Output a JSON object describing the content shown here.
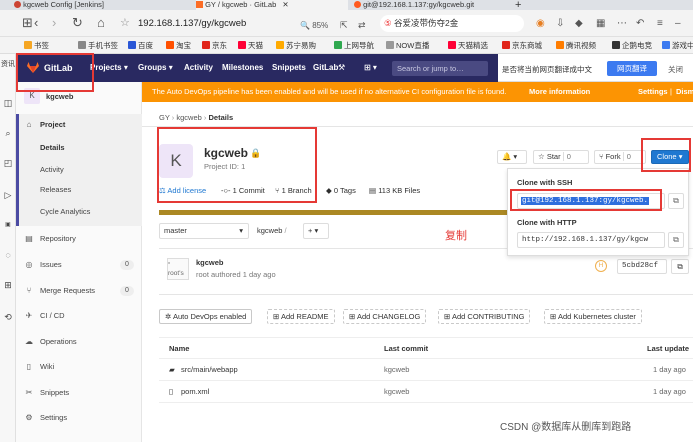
{
  "browser": {
    "tabs": [
      {
        "title": "kgcweb Config [Jenkins]",
        "active": false
      },
      {
        "title": "GY / kgcweb · GitLab",
        "active": true
      },
      {
        "title": "git@192.168.1.137:gy/kgcweb.git",
        "active": false
      }
    ],
    "new_tab": "+",
    "url": "192.168.1.137/gy/kgcweb",
    "zoom": "85%",
    "search_text": "谷爱凌带伤夺2金",
    "bookmarks": [
      "书签",
      "手机书签",
      "百度",
      "淘宝",
      "京东",
      "天猫",
      "苏宁易购",
      "上网导航",
      "NOW直播",
      "天猫精选",
      "京东商城",
      "腾讯视频",
      "企鹅电竞",
      "游戏中"
    ],
    "side_label": "资讯"
  },
  "gitlab": {
    "logo_text": "GitLab",
    "nav": [
      "Projects",
      "Groups",
      "Activity",
      "Milestones",
      "Snippets",
      "GitLab"
    ],
    "search_placeholder": "Search or jump to…"
  },
  "translate_bar": {
    "prompt": "是否将当前网页翻译成中文",
    "button": "网页翻译",
    "close": "关闭"
  },
  "banner": {
    "text": "The Auto DevOps pipeline has been enabled and will be used if no alternative CI configuration file is found.",
    "more": "More information",
    "settings": "Settings",
    "dismiss": "Dism"
  },
  "sidebar": {
    "project_initial": "K",
    "project_name": "kgcweb",
    "items": [
      {
        "label": "Project",
        "count": ""
      },
      {
        "label": "Details",
        "count": ""
      },
      {
        "label": "Activity",
        "count": ""
      },
      {
        "label": "Releases",
        "count": ""
      },
      {
        "label": "Cycle Analytics",
        "count": ""
      },
      {
        "label": "Repository",
        "count": ""
      },
      {
        "label": "Issues",
        "count": "0"
      },
      {
        "label": "Merge Requests",
        "count": "0"
      },
      {
        "label": "CI / CD",
        "count": ""
      },
      {
        "label": "Operations",
        "count": ""
      },
      {
        "label": "Wiki",
        "count": ""
      },
      {
        "label": "Snippets",
        "count": ""
      },
      {
        "label": "Settings",
        "count": ""
      }
    ]
  },
  "breadcrumb": [
    "GY",
    "kgcweb",
    "Details"
  ],
  "project": {
    "initial": "K",
    "name": "kgcweb",
    "id_text": "Project ID: 1",
    "add_license": "Add license",
    "commits": "1 Commit",
    "branches": "1 Branch",
    "tags": "0 Tags",
    "size": "113 KB Files"
  },
  "actions": {
    "star": "Star",
    "star_count": "0",
    "fork": "Fork",
    "fork_count": "0",
    "clone": "Clone"
  },
  "clone_dropdown": {
    "ssh_label": "Clone with SSH",
    "ssh_url": "git@192.168.1.137:gy/kgcweb.",
    "http_label": "Clone with HTTP",
    "http_url": "http://192.168.1.137/gy/kgcw"
  },
  "annotation": "复制",
  "repo_bar": {
    "branch": "master",
    "path": "kgcweb",
    "sep": "/",
    "add": "+"
  },
  "last_commit": {
    "message": "kgcweb",
    "author_line": "root authored 1 day ago",
    "avatar_alt": "root's",
    "hash": "5cbd28cf"
  },
  "quick_buttons": [
    "Auto DevOps enabled",
    "Add README",
    "Add CHANGELOG",
    "Add CONTRIBUTING",
    "Add Kubernetes cluster"
  ],
  "file_table": {
    "headers": [
      "Name",
      "Last commit",
      "Last update"
    ],
    "rows": [
      {
        "name": "src/main/webapp",
        "commit": "kgcweb",
        "update": "1 day ago"
      },
      {
        "name": "pom.xml",
        "commit": "kgcweb",
        "update": "1 day ago"
      }
    ]
  },
  "watermark": "CSDN @数据库从删库到跑路",
  "colors": {
    "header": "#292961",
    "banner": "#fc9403",
    "clone_button": "#1f78d1",
    "highlight": "#e53935"
  }
}
